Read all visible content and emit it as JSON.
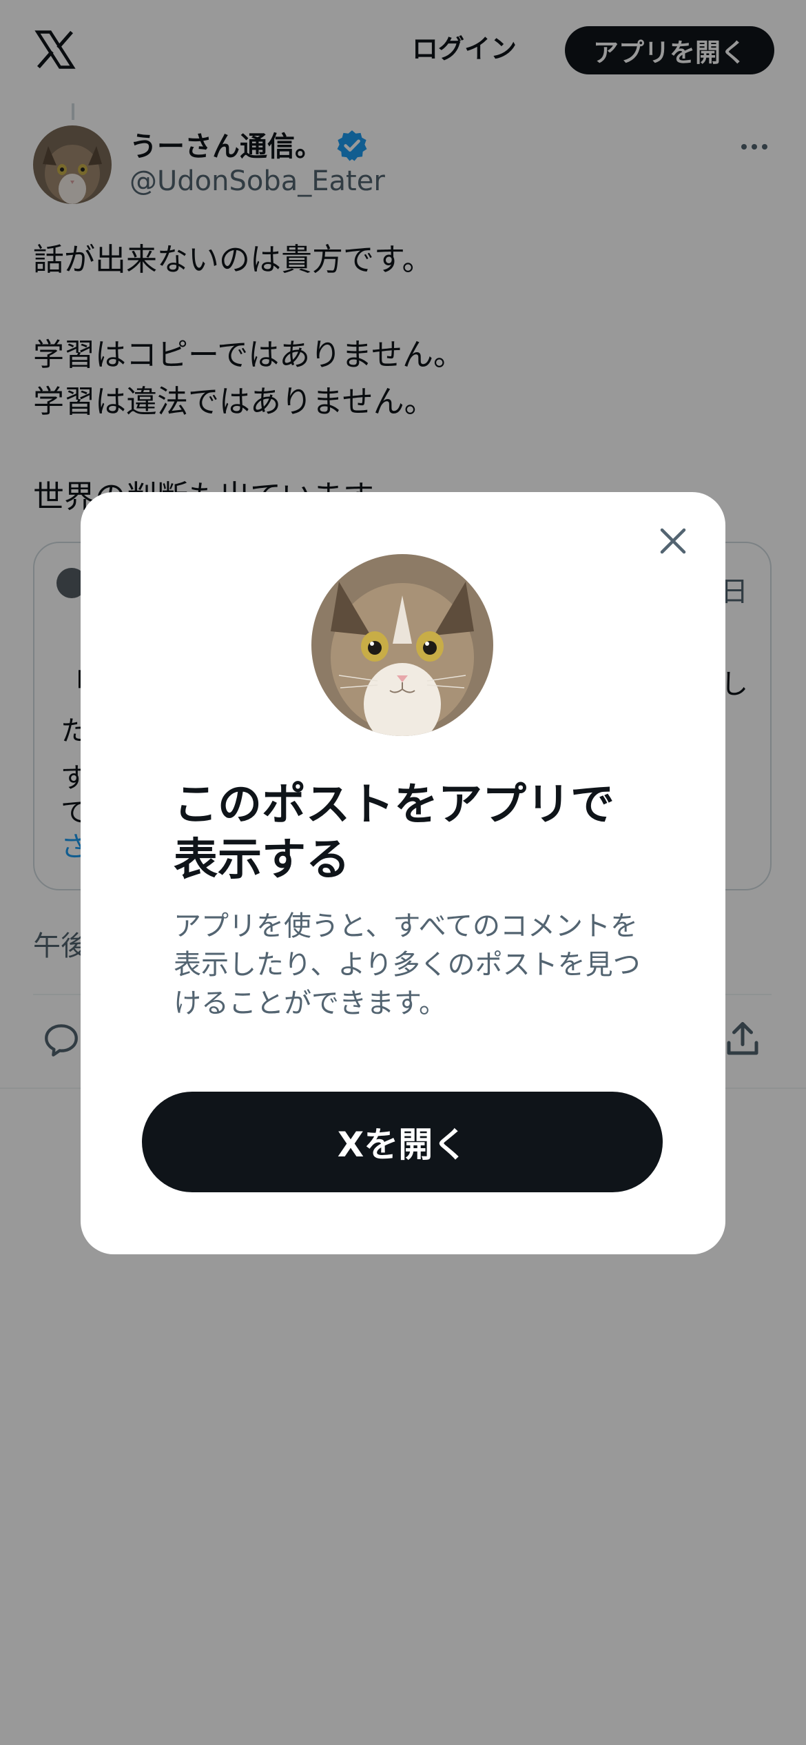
{
  "header": {
    "logo_icon": "x-logo-icon",
    "login_label": "ログイン",
    "open_app_label": "アプリを開く"
  },
  "post": {
    "author_name": "うーさん通信。",
    "handle": "@UdonSoba_Eater",
    "verified_icon": "verified-badge-icon",
    "more_icon": "more-dots-icon",
    "text_lines": [
      "話が出来ないのは貴方です。",
      "学習はコピーではありません。",
      "学習は違法ではありません。",
      "世界の判断も出ています。"
    ],
    "quote": {
      "date_fragment": "日",
      "line_fragments": [
        "「",
        "し",
        "た",
        "す",
        "て"
      ],
      "show_more_fragment": "さ"
    },
    "timestamp_fragment": "午後",
    "actions": {
      "reply_icon": "reply-icon",
      "share_icon": "share-icon"
    }
  },
  "modal": {
    "close_icon": "close-icon",
    "title": "このポストをアプリで表示する",
    "description": "アプリを使うと、すべてのコメントを表示したり、より多くのポストを見つけることができます。",
    "button_label": "Xを開く"
  },
  "colors": {
    "primary_dark": "#0f1419",
    "secondary_text": "#536471",
    "link_blue": "#1d9bf0",
    "verified_blue": "#1d9bf0",
    "overlay": "rgba(0,0,0,0.4)"
  }
}
